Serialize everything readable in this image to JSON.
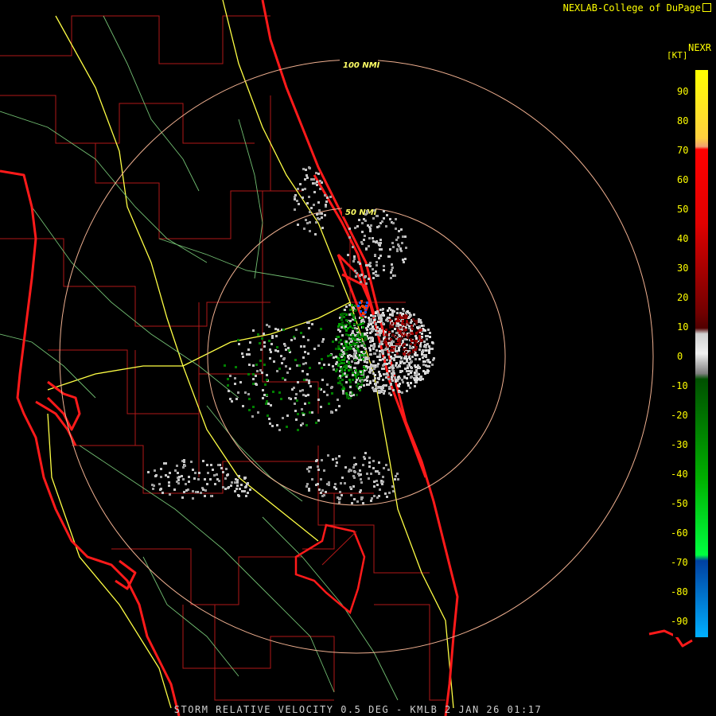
{
  "header": {
    "source": "NEXLAB-College of DuPage",
    "icon": "corner-box-icon"
  },
  "scale": {
    "product": "NEXR",
    "unit": "[KT]",
    "ticks": [
      "90",
      "80",
      "70",
      "60",
      "50",
      "40",
      "30",
      "20",
      "10",
      "0",
      "-10",
      "-20",
      "-30",
      "-40",
      "-50",
      "-60",
      "-70",
      "-80",
      "-90"
    ]
  },
  "rings": {
    "outer": "100 NMI",
    "inner": "50 NMI"
  },
  "footer": {
    "caption": "STORM RELATIVE VELOCITY 0.5 DEG - KMLB 2 JAN 26 01:17"
  },
  "colors": {
    "coast": "#ff1a1a",
    "counties": "#b01818",
    "highways": "#ffff44",
    "roads": "#7fd47f",
    "rings": "#f0b090",
    "text": "#ffff00"
  }
}
